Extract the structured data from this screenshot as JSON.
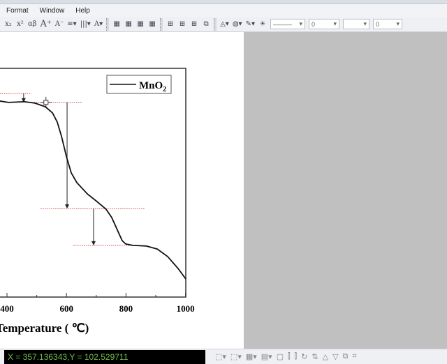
{
  "menu": [
    "Format",
    "Window",
    "Help"
  ],
  "toolbar": {
    "subscript": "x₂",
    "superscript": "x²",
    "greek": "αβ",
    "grow_font": "A⁺",
    "shrink_font": "A⁻",
    "align": "≡▾",
    "columns": "|||▾",
    "font_color": "A▾",
    "line_style_value": "———",
    "line_width_value": "0",
    "fill_value": "",
    "pattern_value": "0"
  },
  "status": {
    "coords": "X = 357.136343,Y = 102.529711"
  },
  "chart_data": {
    "type": "line",
    "title": "",
    "xlabel": "Temperature ( ℃)",
    "ylabel": "",
    "xticks": [
      400,
      600,
      800,
      1000
    ],
    "xlim": [
      376,
      1000
    ],
    "ylim": [
      0,
      100
    ],
    "legend": {
      "label": "MnO",
      "subscript": "2",
      "position": "top-right"
    },
    "series": [
      {
        "name": "MnO2",
        "x": [
          376,
          405,
          459,
          494,
          529,
          553,
          569,
          583,
          600,
          616,
          635,
          670,
          705,
          733,
          752,
          771,
          787,
          799,
          823,
          869,
          905,
          940,
          975,
          1001
        ],
        "y": [
          85.7,
          85.1,
          85.4,
          84.8,
          83.2,
          80.5,
          76.5,
          70.4,
          61.3,
          54.3,
          50.0,
          45.1,
          41.5,
          38.4,
          34.8,
          29.3,
          24.7,
          23.2,
          22.6,
          22.3,
          21.0,
          17.7,
          12.5,
          7.9
        ]
      }
    ],
    "reference_lines": [
      {
        "y": 89.0,
        "x": [
          376,
          482
        ]
      },
      {
        "y": 85.1,
        "x": [
          470,
          654
        ]
      },
      {
        "y": 38.7,
        "x": [
          513,
          865
        ]
      },
      {
        "y": 22.6,
        "x": [
          623,
          865
        ]
      }
    ],
    "arrows": [
      {
        "x": 456,
        "from": 89.0,
        "to": 85.1
      },
      {
        "x": 602,
        "from": 85.1,
        "to": 38.7
      },
      {
        "x": 691,
        "from": 38.7,
        "to": 22.6
      }
    ],
    "cursor": {
      "x": 531,
      "y": 85.1
    }
  }
}
